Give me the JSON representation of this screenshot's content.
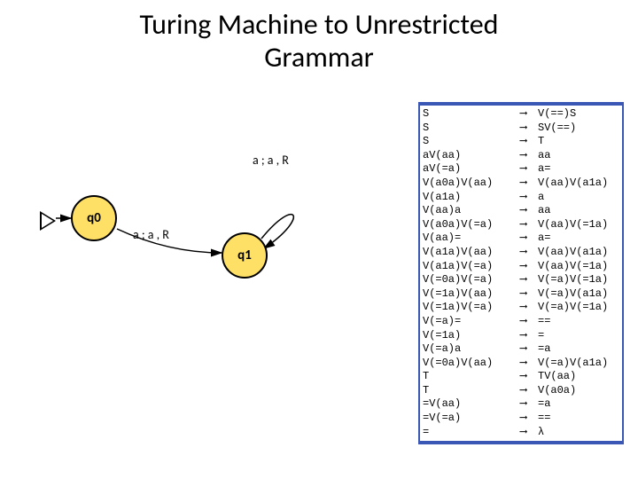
{
  "title_line1": "Turing Machine to Unrestricted",
  "title_line2": "Grammar",
  "states": {
    "q0": "q0",
    "q1": "q1"
  },
  "edge_labels": {
    "loop_q1": "a ; a , R",
    "q0_q1": "a ; a , R"
  },
  "arrow_symbol": "⟶",
  "rules": [
    {
      "lhs": "S",
      "rhs": "V(==)S"
    },
    {
      "lhs": "S",
      "rhs": "SV(==)"
    },
    {
      "lhs": "S",
      "rhs": "T"
    },
    {
      "lhs": "aV(aa)",
      "rhs": "aa"
    },
    {
      "lhs": "aV(=a)",
      "rhs": "a="
    },
    {
      "lhs": "V(a0a)V(aa)",
      "rhs": "V(aa)V(a1a)"
    },
    {
      "lhs": "V(a1a)",
      "rhs": "a"
    },
    {
      "lhs": "V(aa)a",
      "rhs": "aa"
    },
    {
      "lhs": "V(a0a)V(=a)",
      "rhs": "V(aa)V(=1a)"
    },
    {
      "lhs": "V(aa)=",
      "rhs": "a="
    },
    {
      "lhs": "V(a1a)V(aa)",
      "rhs": "V(aa)V(a1a)"
    },
    {
      "lhs": "V(a1a)V(=a)",
      "rhs": "V(aa)V(=1a)"
    },
    {
      "lhs": "V(=0a)V(=a)",
      "rhs": "V(=a)V(=1a)"
    },
    {
      "lhs": "V(=1a)V(aa)",
      "rhs": "V(=a)V(a1a)"
    },
    {
      "lhs": "V(=1a)V(=a)",
      "rhs": "V(=a)V(=1a)"
    },
    {
      "lhs": "V(=a)=",
      "rhs": "=="
    },
    {
      "lhs": "V(=1a)",
      "rhs": "="
    },
    {
      "lhs": "V(=a)a",
      "rhs": "=a"
    },
    {
      "lhs": "V(=0a)V(aa)",
      "rhs": "V(=a)V(a1a)"
    },
    {
      "lhs": "T",
      "rhs": "TV(aa)"
    },
    {
      "lhs": "T",
      "rhs": "V(a0a)"
    },
    {
      "lhs": "=V(aa)",
      "rhs": "=a"
    },
    {
      "lhs": "=V(=a)",
      "rhs": "=="
    },
    {
      "lhs": "=",
      "rhs": "λ"
    }
  ]
}
